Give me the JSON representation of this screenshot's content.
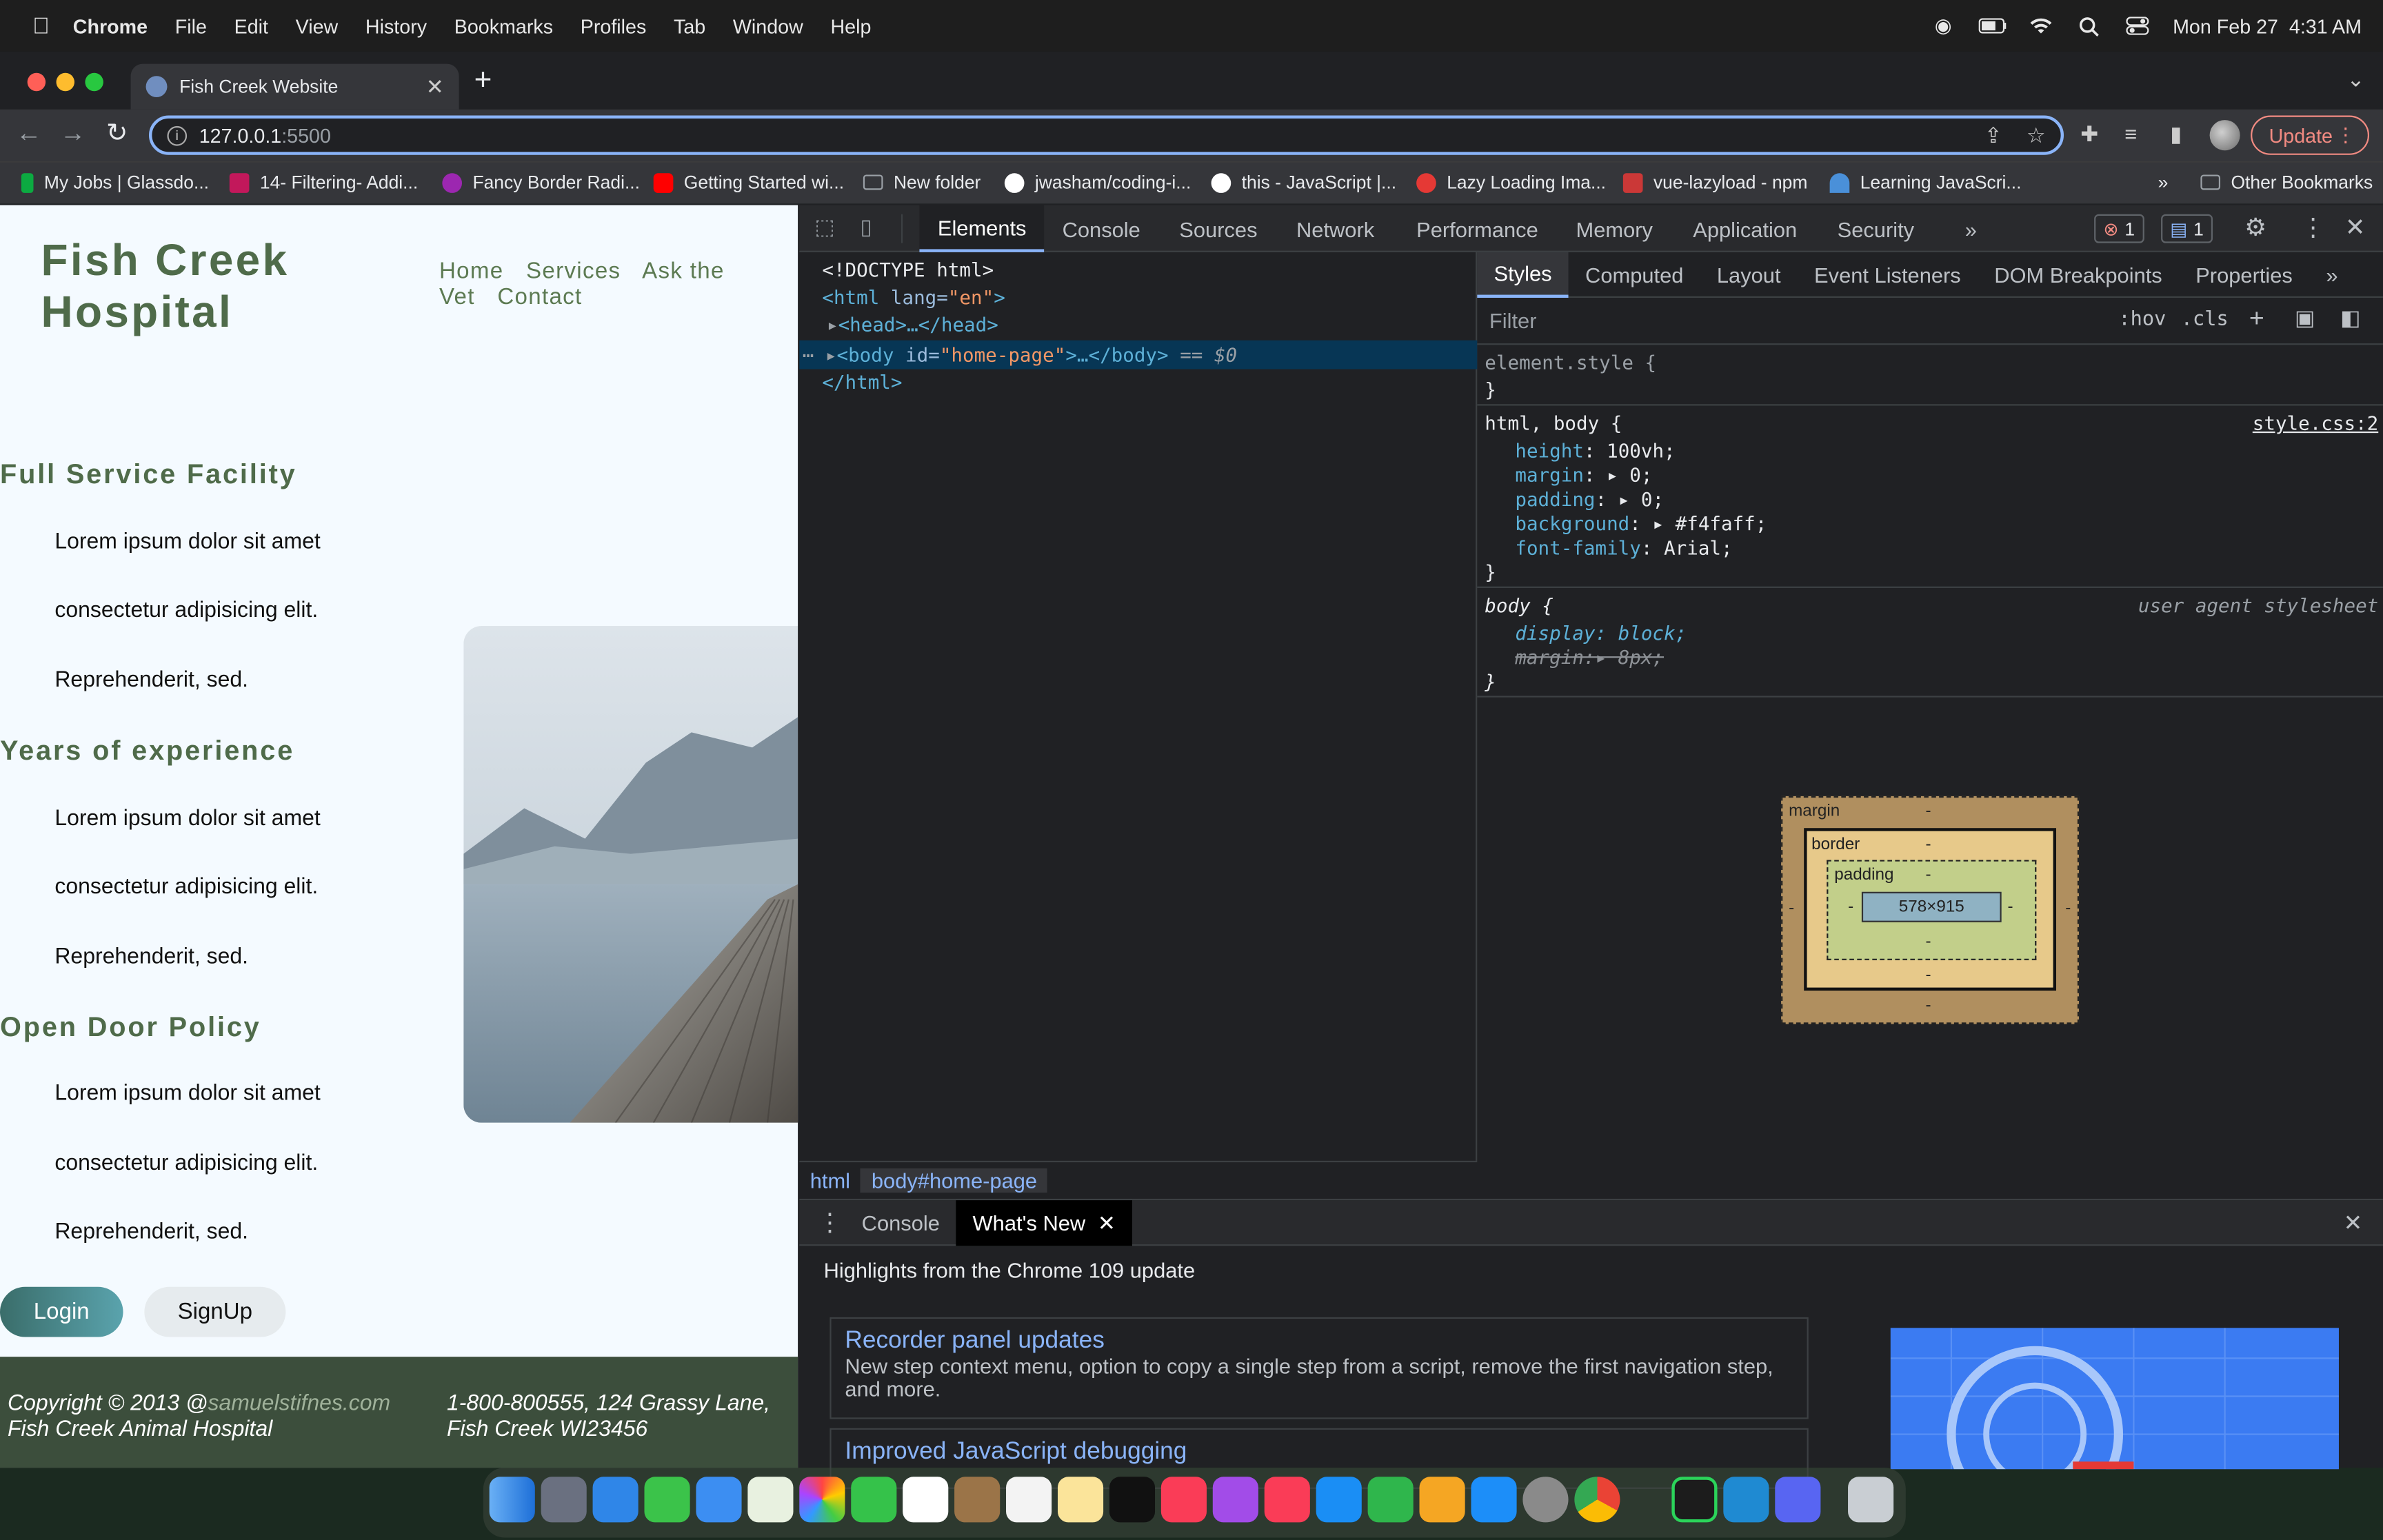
{
  "menubar": {
    "app": "Chrome",
    "items": [
      "File",
      "Edit",
      "View",
      "History",
      "Bookmarks",
      "Profiles",
      "Tab",
      "Window",
      "Help"
    ],
    "datetime": "Mon Feb 27  4:31 AM"
  },
  "browser": {
    "tab_title": "Fish Creek Website",
    "url_host": "127.0.0.1",
    "url_port": ":5500",
    "update_label": "Update",
    "bookmarks": [
      {
        "label": "My Jobs | Glassdo...",
        "color": "#0caa41"
      },
      {
        "label": "14- Filtering- Addi...",
        "color": "#c2185b"
      },
      {
        "label": "Fancy Border Radi...",
        "color": "#9c27b0"
      },
      {
        "label": "Getting Started wi...",
        "color": "#ff0000"
      },
      {
        "label": "New folder",
        "color": "#9aa0a6"
      },
      {
        "label": "jwasham/coding-i...",
        "color": "#ffffff"
      },
      {
        "label": "this - JavaScript |...",
        "color": "#ffffff"
      },
      {
        "label": "Lazy Loading Ima...",
        "color": "#e53935"
      },
      {
        "label": "vue-lazyload - npm",
        "color": "#cb3837"
      },
      {
        "label": "Learning JavaScri...",
        "color": "#4a90d9"
      }
    ],
    "bookmarks_more": "»",
    "other_bookmarks": "Other Bookmarks"
  },
  "page": {
    "logo": "Fish Creek Hospital",
    "nav": [
      "Home",
      "Services",
      "Ask the Vet",
      "Contact"
    ],
    "sections": [
      {
        "title": "Full Service Facility",
        "items": [
          "Lorem ipsum dolor sit amet",
          "consectetur adipisicing elit.",
          "Reprehenderit, sed."
        ]
      },
      {
        "title": "Years of experience",
        "items": [
          "Lorem ipsum dolor sit amet",
          "consectetur adipisicing elit.",
          "Reprehenderit, sed."
        ]
      },
      {
        "title": "Open Door Policy",
        "items": [
          "Lorem ipsum dolor sit amet",
          "consectetur adipisicing elit.",
          "Reprehenderit, sed."
        ]
      }
    ],
    "login_label": "Login",
    "signup_label": "SignUp",
    "footer": {
      "copyright_prefix": "Copyright © 2013 @",
      "copyright_link": "samuelstifnes.com",
      "copyright_name": "Fish Creek Animal Hospital",
      "address_line1": "1-800-800555, 124 Grassy Lane,",
      "address_line2": "Fish Creek WI23456"
    }
  },
  "devtools": {
    "tabs": [
      "Elements",
      "Console",
      "Sources",
      "Network",
      "Performance",
      "Memory",
      "Application",
      "Security"
    ],
    "more": "»",
    "error_count": "1",
    "message_count": "1",
    "dom": {
      "doctype": "<!DOCTYPE html>",
      "html_open_tag": "<html",
      "html_attr": " lang=",
      "html_attr_val": "\"en\"",
      "html_close_bracket": ">",
      "head": "<head>…</head>",
      "body_tag": "<body",
      "body_attr": " id=",
      "body_attr_val": "\"home-page\"",
      "body_rest": ">…</body>",
      "body_marker": "== $0",
      "html_close": "</html>"
    },
    "breadcrumbs": [
      "html",
      "body#home-page"
    ],
    "styles_tabs": [
      "Styles",
      "Computed",
      "Layout",
      "Event Listeners",
      "DOM Breakpoints",
      "Properties"
    ],
    "filter_placeholder": "Filter",
    "hov": ":hov",
    "cls": ".cls",
    "rules": {
      "element_style": "element.style {",
      "rule1_selector": "html, body {",
      "rule1_source": "style.css:2",
      "rule1_props": [
        {
          "name": "height",
          "value": "100vh;"
        },
        {
          "name": "margin",
          "value": "▸ 0;"
        },
        {
          "name": "padding",
          "value": "▸ 0;"
        },
        {
          "name": "background",
          "value": "▸ #f4faff;"
        },
        {
          "name": "font-family",
          "value": "Arial;"
        }
      ],
      "rule2_selector": "body {",
      "rule2_source": "user agent stylesheet",
      "rule2_display": "display: block;",
      "rule2_margin": "margin:▸ 8px;",
      "close": "}"
    },
    "boxmodel": {
      "margin": "margin",
      "border": "border",
      "padding": "padding",
      "content": "578×915",
      "dash": "-"
    },
    "drawer": {
      "tabs": [
        "Console",
        "What's New"
      ],
      "heading": "Highlights from the Chrome 109 update",
      "cards": [
        {
          "title": "Recorder panel updates",
          "desc": "New step context menu, option to copy a single step from a script, remove the first navigation step, and more."
        },
        {
          "title": "Improved JavaScript debugging",
          "desc": ""
        }
      ]
    }
  }
}
